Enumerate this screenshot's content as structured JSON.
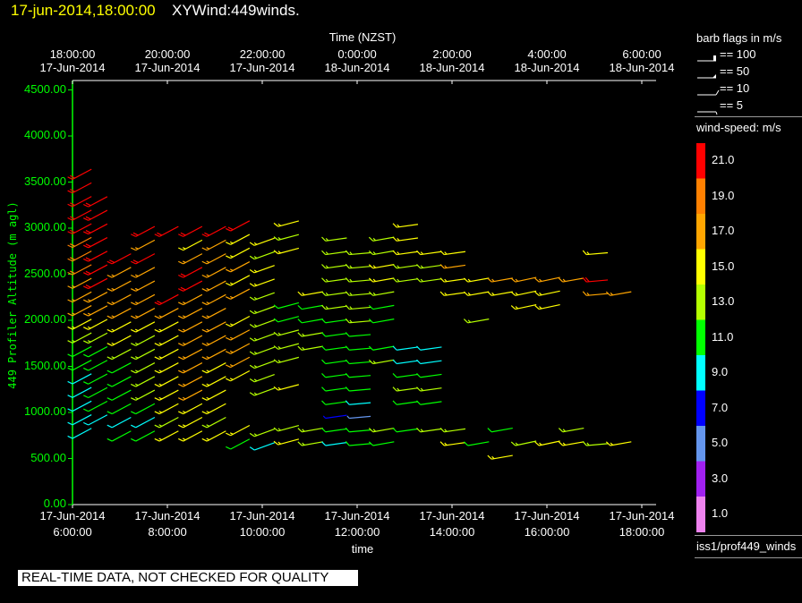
{
  "header": {
    "datetime": "17-jun-2014,18:00:00",
    "title": "XYWind:449winds."
  },
  "legend": {
    "barb_title": "barb flags in m/s",
    "barbs": [
      {
        "value_label": "== 100",
        "flag": "pennant-100"
      },
      {
        "value_label": "== 50",
        "flag": "pennant-50"
      },
      {
        "value_label": "== 10",
        "flag": "full-barb"
      },
      {
        "value_label": "== 5",
        "flag": "half-barb"
      }
    ],
    "colorbar_title": "wind-speed: m/s",
    "colorbar": [
      {
        "label": "21.0",
        "color": "#ff0000"
      },
      {
        "label": "19.0",
        "color": "#ff8000"
      },
      {
        "label": "17.0",
        "color": "#ffa500"
      },
      {
        "label": "15.0",
        "color": "#ffff00"
      },
      {
        "label": "13.0",
        "color": "#b4ff00"
      },
      {
        "label": "11.0",
        "color": "#00ff00"
      },
      {
        "label": "9.0",
        "color": "#00ffff"
      },
      {
        "label": "7.0",
        "color": "#0000ff"
      },
      {
        "label": "5.0",
        "color": "#6495ed"
      },
      {
        "label": "3.0",
        "color": "#a020f0"
      },
      {
        "label": "1.0",
        "color": "#ee82ee"
      }
    ],
    "source": "iss1/prof449_winds"
  },
  "footer": "REAL-TIME DATA, NOT CHECKED FOR QUALITY",
  "chart_data": {
    "type": "wind-barb",
    "title": "XYWind:449winds.",
    "xlabel": "time",
    "x2label": "Time (NZST)",
    "ylabel": "449 Profiler Altitude (m agl)",
    "xlim": [
      "17-Jun-2014 6:00:00",
      "17-Jun-2014 18:30:00"
    ],
    "ylim": [
      0,
      4600
    ],
    "x_ticks": [
      {
        "date": "17-Jun-2014",
        "time": "6:00:00",
        "hour": 6
      },
      {
        "date": "17-Jun-2014",
        "time": "8:00:00",
        "hour": 8
      },
      {
        "date": "17-Jun-2014",
        "time": "10:00:00",
        "hour": 10
      },
      {
        "date": "17-Jun-2014",
        "time": "12:00:00",
        "hour": 12
      },
      {
        "date": "17-Jun-2014",
        "time": "14:00:00",
        "hour": 14
      },
      {
        "date": "17-Jun-2014",
        "time": "16:00:00",
        "hour": 16
      },
      {
        "date": "17-Jun-2014",
        "time": "18:00:00",
        "hour": 18
      }
    ],
    "x2_ticks": [
      {
        "time": "18:00:00",
        "date": "17-Jun-2014"
      },
      {
        "time": "20:00:00",
        "date": "17-Jun-2014"
      },
      {
        "time": "22:00:00",
        "date": "17-Jun-2014"
      },
      {
        "time": "0:00:00",
        "date": "18-Jun-2014"
      },
      {
        "time": "2:00:00",
        "date": "18-Jun-2014"
      },
      {
        "time": "4:00:00",
        "date": "18-Jun-2014"
      },
      {
        "time": "6:00:00",
        "date": "18-Jun-2014"
      }
    ],
    "y_ticks": [
      "4500.00",
      "4000.00",
      "3500.00",
      "3000.00",
      "2500.00",
      "2000.00",
      "1500.00",
      "1000.00",
      "500.00",
      "0.00"
    ],
    "speed_units": "m/s",
    "gate_spacing_m": 148,
    "profiles": [
      {
        "time": "06:00",
        "alt0": 718,
        "dir": 62,
        "speeds": [
          9,
          9,
          9,
          9,
          9,
          11,
          11,
          13,
          15,
          17,
          17,
          17,
          19,
          19,
          19,
          21,
          21,
          21,
          21,
          21
        ]
      },
      {
        "time": "06:20",
        "alt0": 864,
        "dir": 62,
        "speeds": [
          9,
          11,
          11,
          11,
          11,
          11,
          13,
          15,
          17,
          17,
          21,
          21,
          21,
          21,
          21,
          21,
          21
        ]
      },
      {
        "time": "06:50",
        "alt0": 689,
        "dir": 62,
        "speeds": [
          11,
          9,
          11,
          11,
          11,
          11,
          13,
          15,
          15,
          17,
          17,
          17,
          17,
          21
        ]
      },
      {
        "time": "07:20",
        "alt0": 689,
        "dir": 62,
        "speeds": [
          11,
          9,
          11,
          13,
          13,
          13,
          13,
          13,
          15,
          17,
          17,
          17,
          17,
          21,
          17,
          21
        ]
      },
      {
        "time": "07:50",
        "alt0": 689,
        "dir": 62,
        "speeds": [
          15,
          13,
          15,
          15,
          15,
          15,
          15,
          15,
          15,
          17,
          21,
          null,
          null,
          null,
          null,
          21
        ]
      },
      {
        "time": "08:20",
        "alt0": 689,
        "dir": 62,
        "speeds": [
          15,
          15,
          15,
          17,
          17,
          17,
          17,
          17,
          17,
          17,
          17,
          21,
          21,
          17,
          15,
          21
        ]
      },
      {
        "time": "08:50",
        "alt0": 689,
        "dir": 62,
        "speeds": [
          15,
          13,
          15,
          15,
          15,
          15,
          17,
          17,
          17,
          17,
          17,
          17,
          17,
          17,
          17,
          21
        ]
      },
      {
        "time": "09:20",
        "alt0": 602,
        "dir": 62,
        "speeds": [
          11,
          15,
          null,
          null,
          null,
          15,
          17,
          17,
          17,
          15,
          null,
          17,
          15,
          17,
          15,
          15,
          21
        ]
      },
      {
        "time": "09:50",
        "alt0": 592,
        "dir": 70,
        "speeds": [
          9,
          13,
          null,
          null,
          13,
          13,
          13,
          13,
          13,
          13,
          13,
          13,
          15,
          15,
          13,
          15
        ]
      },
      {
        "time": "10:20",
        "alt0": 650,
        "dir": 75,
        "speeds": [
          15,
          13,
          null,
          null,
          15,
          null,
          13,
          13,
          13,
          11,
          11,
          null,
          null,
          null,
          15,
          13,
          15
        ]
      },
      {
        "time": "10:50",
        "alt0": 641,
        "dir": 80,
        "speeds": [
          13,
          13,
          null,
          null,
          null,
          null,
          null,
          13,
          13,
          11,
          11,
          15
        ]
      },
      {
        "time": "11:20",
        "alt0": 641,
        "dir": 82,
        "speeds": [
          9,
          11,
          7,
          11,
          11,
          11,
          11,
          11,
          11,
          11,
          13,
          13,
          13,
          13,
          13,
          13
        ]
      },
      {
        "time": "11:50",
        "alt0": 641,
        "dir": 85,
        "speeds": [
          11,
          11,
          5,
          9,
          11,
          11,
          11,
          11,
          11,
          13,
          13,
          13,
          13,
          13,
          13
        ]
      },
      {
        "time": "12:20",
        "alt0": 641,
        "dir": 80,
        "speeds": [
          11,
          13,
          null,
          null,
          null,
          null,
          13,
          11,
          null,
          11,
          11,
          13,
          15,
          15,
          13,
          13
        ]
      },
      {
        "time": "12:50",
        "alt0": 641,
        "dir": 82,
        "speeds": [
          null,
          11,
          null,
          11,
          13,
          11,
          9,
          9,
          null,
          null,
          null,
          null,
          13,
          13,
          15,
          15,
          15
        ]
      },
      {
        "time": "13:20",
        "alt0": 641,
        "dir": 82,
        "speeds": [
          null,
          13,
          null,
          11,
          13,
          11,
          9,
          9,
          null,
          null,
          null,
          null,
          13,
          13,
          15
        ]
      },
      {
        "time": "13:50",
        "alt0": 641,
        "dir": 82,
        "speeds": [
          15,
          13,
          null,
          null,
          null,
          null,
          null,
          null,
          null,
          null,
          null,
          15,
          15,
          17,
          15
        ]
      },
      {
        "time": "14:20",
        "alt0": 641,
        "dir": 80,
        "speeds": [
          11,
          null,
          null,
          null,
          null,
          null,
          null,
          null,
          null,
          13,
          null,
          15,
          15
        ]
      },
      {
        "time": "14:50",
        "alt0": 493,
        "dir": 80,
        "speeds": [
          15,
          null,
          11,
          null,
          null,
          null,
          null,
          null,
          null,
          null,
          null,
          null,
          15,
          17
        ]
      },
      {
        "time": "15:20",
        "alt0": 641,
        "dir": 78,
        "speeds": [
          13,
          null,
          null,
          null,
          null,
          null,
          null,
          null,
          null,
          null,
          15,
          15,
          17
        ]
      },
      {
        "time": "15:50",
        "alt0": 641,
        "dir": 78,
        "speeds": [
          15,
          null,
          null,
          null,
          null,
          null,
          null,
          null,
          null,
          null,
          15,
          15,
          17
        ]
      },
      {
        "time": "16:20",
        "alt0": 641,
        "dir": 80,
        "speeds": [
          15,
          13,
          null,
          null,
          null,
          null,
          null,
          null,
          null,
          null,
          null,
          null,
          17
        ]
      },
      {
        "time": "16:50",
        "alt0": 641,
        "dir": 85,
        "speeds": [
          13,
          null,
          null,
          null,
          null,
          null,
          null,
          null,
          null,
          null,
          null,
          17,
          21,
          null,
          15
        ]
      },
      {
        "time": "17:20",
        "alt0": 641,
        "dir": 80,
        "speeds": [
          15,
          null,
          null,
          null,
          null,
          null,
          null,
          null,
          null,
          null,
          null,
          17
        ]
      }
    ]
  }
}
